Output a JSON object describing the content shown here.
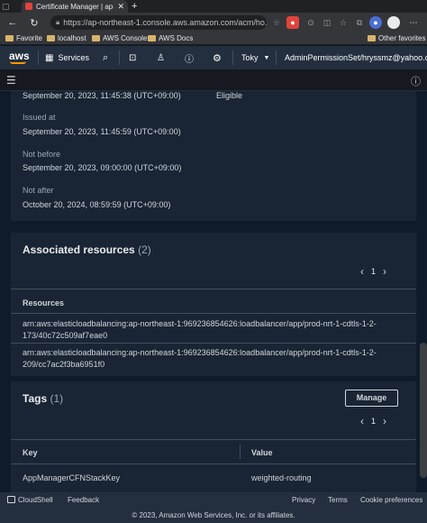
{
  "browser": {
    "tab_title": "Certificate Manager | ap-n",
    "url": "https://ap-northeast-1.console.aws.amazon.com/acm/ho...",
    "bookmarks": [
      "Favorite",
      "localhost",
      "AWS Console",
      "AWS Docs"
    ],
    "other_bookmarks": "Other favorites"
  },
  "aws_header": {
    "logo": "aws",
    "services_label": "Services",
    "region": "Toky",
    "account": "AdminPermissionSet/hryssmz@yahoo.c"
  },
  "details": {
    "partial_date": "September 20, 2023, 11:45:38 (UTC+09:00)",
    "partial_status": "Eligible",
    "issued_at_label": "Issued at",
    "issued_at": "September 20, 2023, 11:45:59 (UTC+09:00)",
    "not_before_label": "Not before",
    "not_before": "September 20, 2023, 09:00:00 (UTC+09:00)",
    "not_after_label": "Not after",
    "not_after": "October 20, 2024, 08:59:59 (UTC+09:00)"
  },
  "associated": {
    "title": "Associated resources",
    "count": "(2)",
    "page": "1",
    "column": "Resources",
    "rows": [
      {
        "line1": "arn:aws:elasticloadbalancing:ap-northeast-1:969236854626:loadbalancer/app/prod-nrt-1-cdtls-1-2-",
        "line2": "173/40c72c509af7eae0"
      },
      {
        "line1": "arn:aws:elasticloadbalancing:ap-northeast-1:969236854626:loadbalancer/app/prod-nrt-1-cdtls-1-2-",
        "line2": "209/cc7ac2f3ba6951f0"
      }
    ]
  },
  "tags": {
    "title": "Tags",
    "count": "(1)",
    "manage_label": "Manage",
    "page": "1",
    "col_key": "Key",
    "col_value": "Value",
    "rows": [
      {
        "key": "AppManagerCFNStackKey",
        "value": "weighted-routing"
      }
    ]
  },
  "footer": {
    "cloudshell": "CloudShell",
    "feedback": "Feedback",
    "privacy": "Privacy",
    "terms": "Terms",
    "cookie": "Cookie preferences",
    "copyright": "© 2023, Amazon Web Services, Inc. or its affiliates."
  }
}
